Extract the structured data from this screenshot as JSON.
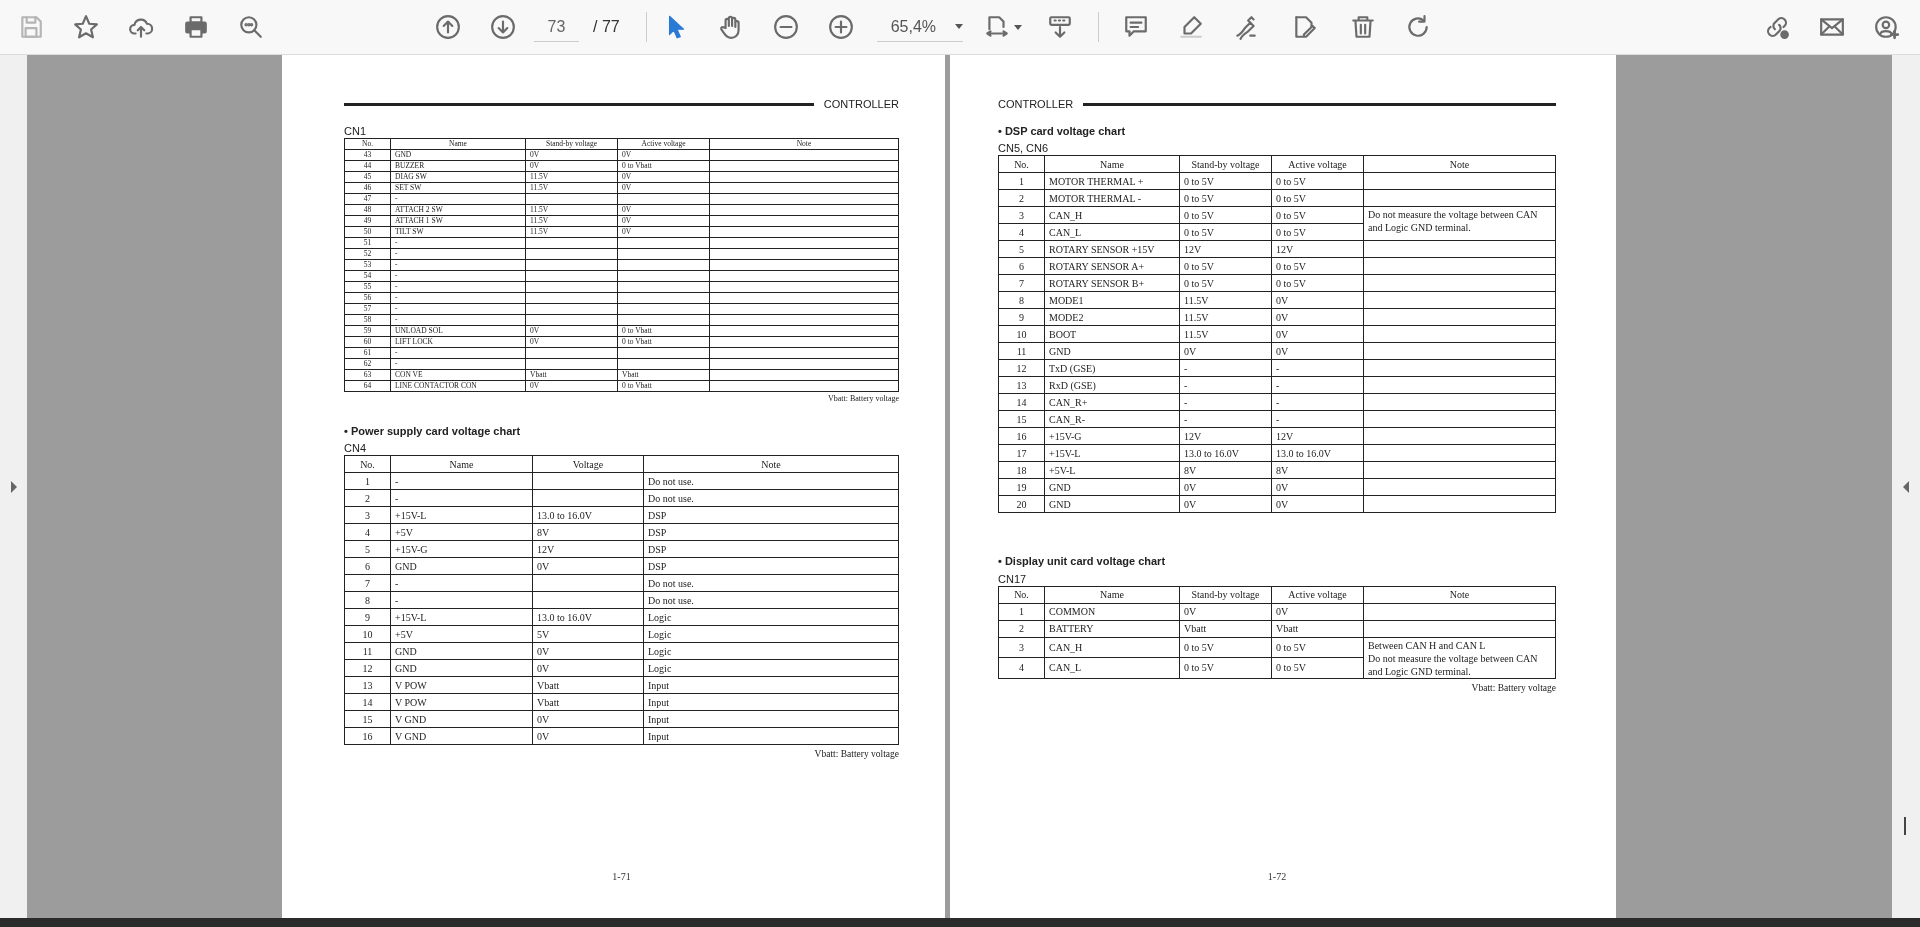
{
  "toolbar": {
    "save_disabled": true,
    "page_number": "73",
    "page_total": "/ 77",
    "zoom": "65,4%",
    "tools": [
      {
        "kind": "select",
        "selected": true
      },
      {
        "kind": "hand",
        "selected": false
      }
    ]
  },
  "pages": [
    {
      "header": "CONTROLLER",
      "page_number": "1-71",
      "sections": [
        {
          "title": "CN1",
          "kind": "standby_active",
          "columns": [
            "No.",
            "Name",
            "Stand-by voltage",
            "Active voltage",
            "Note"
          ],
          "rows": [
            {
              "no": "43",
              "name": "GND",
              "standby": "0V",
              "active": "0V"
            },
            {
              "no": "44",
              "name": "BUZZER",
              "standby": "0V",
              "active": "0 to Vbatt"
            },
            {
              "no": "45",
              "name": "DIAG SW",
              "standby": "11.5V",
              "active": "0V"
            },
            {
              "no": "46",
              "name": "SET SW",
              "standby": "11.5V",
              "active": "0V"
            },
            {
              "no": "47",
              "name": "-"
            },
            {
              "no": "48",
              "name": "ATTACH 2 SW",
              "standby": "11.5V",
              "active": "0V"
            },
            {
              "no": "49",
              "name": "ATTACH 1 SW",
              "standby": "11.5V",
              "active": "0V"
            },
            {
              "no": "50",
              "name": "TILT SW",
              "standby": "11.5V",
              "active": "0V"
            },
            {
              "no": "51",
              "name": "-"
            },
            {
              "no": "52",
              "name": "-"
            },
            {
              "no": "53",
              "name": "-"
            },
            {
              "no": "54",
              "name": "-"
            },
            {
              "no": "55",
              "name": "-"
            },
            {
              "no": "56",
              "name": "-"
            },
            {
              "no": "57",
              "name": "-"
            },
            {
              "no": "58",
              "name": "-"
            },
            {
              "no": "59",
              "name": "UNLOAD SOL",
              "standby": "0V",
              "active": "0 to Vbatt"
            },
            {
              "no": "60",
              "name": "LIFT LOCK",
              "standby": "0V",
              "active": "0 to Vbatt"
            },
            {
              "no": "61",
              "name": "-"
            },
            {
              "no": "62",
              "name": "-"
            },
            {
              "no": "63",
              "name": "CON VE",
              "standby": "Vbatt",
              "active": "Vbatt"
            },
            {
              "no": "64",
              "name": "LINE CONTACTOR CON",
              "standby": "0V",
              "active": "0 to Vbatt"
            }
          ],
          "footnote": "Vbatt: Battery voltage"
        },
        {
          "heading": "• Power supply card voltage chart",
          "title": "CN4",
          "kind": "single_voltage",
          "columns": [
            "No.",
            "Name",
            "Voltage",
            "Note"
          ],
          "rows": [
            {
              "no": "1",
              "name": "-",
              "note": "Do not use."
            },
            {
              "no": "2",
              "name": "-",
              "note": "Do not use."
            },
            {
              "no": "3",
              "name": "+15V-L",
              "voltage": "13.0 to 16.0V",
              "note": "DSP"
            },
            {
              "no": "4",
              "name": "+5V",
              "voltage": "8V",
              "note": "DSP"
            },
            {
              "no": "5",
              "name": "+15V-G",
              "voltage": "12V",
              "note": "DSP"
            },
            {
              "no": "6",
              "name": "GND",
              "voltage": "0V",
              "note": "DSP"
            },
            {
              "no": "7",
              "name": "-",
              "note": "Do not use."
            },
            {
              "no": "8",
              "name": "-",
              "note": "Do not use."
            },
            {
              "no": "9",
              "name": "+15V-L",
              "voltage": "13.0 to 16.0V",
              "note": "Logic"
            },
            {
              "no": "10",
              "name": "+5V",
              "voltage": "5V",
              "note": "Logic"
            },
            {
              "no": "11",
              "name": "GND",
              "voltage": "0V",
              "note": "Logic"
            },
            {
              "no": "12",
              "name": "GND",
              "voltage": "0V",
              "note": "Logic"
            },
            {
              "no": "13",
              "name": "V POW",
              "voltage": "Vbatt",
              "note": "Input"
            },
            {
              "no": "14",
              "name": "V POW",
              "voltage": "Vbatt",
              "note": "Input"
            },
            {
              "no": "15",
              "name": "V GND",
              "voltage": "0V",
              "note": "Input"
            },
            {
              "no": "16",
              "name": "V GND",
              "voltage": "0V",
              "note": "Input"
            }
          ],
          "footnote": "Vbatt: Battery voltage"
        }
      ]
    },
    {
      "header": "CONTROLLER",
      "page_number": "1-72",
      "sections": [
        {
          "heading": "• DSP card voltage chart",
          "title": "CN5, CN6",
          "kind": "standby_active",
          "columns": [
            "No.",
            "Name",
            "Stand-by voltage",
            "Active voltage",
            "Note"
          ],
          "rows": [
            {
              "no": "1",
              "name": "MOTOR THERMAL +",
              "standby": "0 to 5V",
              "active": "0 to 5V"
            },
            {
              "no": "2",
              "name": "MOTOR THERMAL -",
              "standby": "0 to 5V",
              "active": "0 to 5V"
            },
            {
              "no": "3",
              "name": "CAN_H",
              "standby": "0 to 5V",
              "active": "0 to 5V",
              "note": "Do not measure the voltage between CAN and Logic GND terminal.",
              "note_spans_next": true
            },
            {
              "no": "4",
              "name": "CAN_L",
              "standby": "0 to 5V",
              "active": "0 to 5V"
            },
            {
              "no": "5",
              "name": "ROTARY SENSOR +15V",
              "standby": "12V",
              "active": "12V"
            },
            {
              "no": "6",
              "name": "ROTARY SENSOR A+",
              "standby": "0 to 5V",
              "active": "0 to 5V"
            },
            {
              "no": "7",
              "name": "ROTARY SENSOR B+",
              "standby": "0 to 5V",
              "active": "0 to 5V"
            },
            {
              "no": "8",
              "name": "MODE1",
              "standby": "11.5V",
              "active": "0V"
            },
            {
              "no": "9",
              "name": "MODE2",
              "standby": "11.5V",
              "active": "0V"
            },
            {
              "no": "10",
              "name": "BOOT",
              "standby": "11.5V",
              "active": "0V"
            },
            {
              "no": "11",
              "name": "GND",
              "standby": "0V",
              "active": "0V"
            },
            {
              "no": "12",
              "name": "TxD (GSE)",
              "standby": "-",
              "active": "-"
            },
            {
              "no": "13",
              "name": "RxD (GSE)",
              "standby": "-",
              "active": "-"
            },
            {
              "no": "14",
              "name": "CAN_R+",
              "standby": "-",
              "active": "-"
            },
            {
              "no": "15",
              "name": "CAN_R-",
              "standby": "-",
              "active": "-"
            },
            {
              "no": "16",
              "name": "+15V-G",
              "standby": "12V",
              "active": "12V"
            },
            {
              "no": "17",
              "name": "+15V-L",
              "standby": "13.0 to 16.0V",
              "active": "13.0 to 16.0V"
            },
            {
              "no": "18",
              "name": "+5V-L",
              "standby": "8V",
              "active": "8V"
            },
            {
              "no": "19",
              "name": "GND",
              "standby": "0V",
              "active": "0V"
            },
            {
              "no": "20",
              "name": "GND",
              "standby": "0V",
              "active": "0V"
            }
          ]
        },
        {
          "heading": "• Display unit card voltage chart",
          "title": "CN17",
          "kind": "standby_active",
          "columns": [
            "No.",
            "Name",
            "Stand-by voltage",
            "Active voltage",
            "Note"
          ],
          "rows": [
            {
              "no": "1",
              "name": "COMMON",
              "standby": "0V",
              "active": "0V"
            },
            {
              "no": "2",
              "name": "BATTERY",
              "standby": "Vbatt",
              "active": "Vbatt"
            },
            {
              "no": "3",
              "name": "CAN_H",
              "standby": "0 to 5V",
              "active": "0 to 5V",
              "note": "Between CAN H and CAN L\nDo not measure the voltage between CAN and Logic GND terminal.",
              "note_spans_next": true
            },
            {
              "no": "4",
              "name": "CAN_L",
              "standby": "0 to 5V",
              "active": "0 to 5V"
            }
          ],
          "footnote": "Vbatt: Battery voltage"
        }
      ]
    }
  ]
}
